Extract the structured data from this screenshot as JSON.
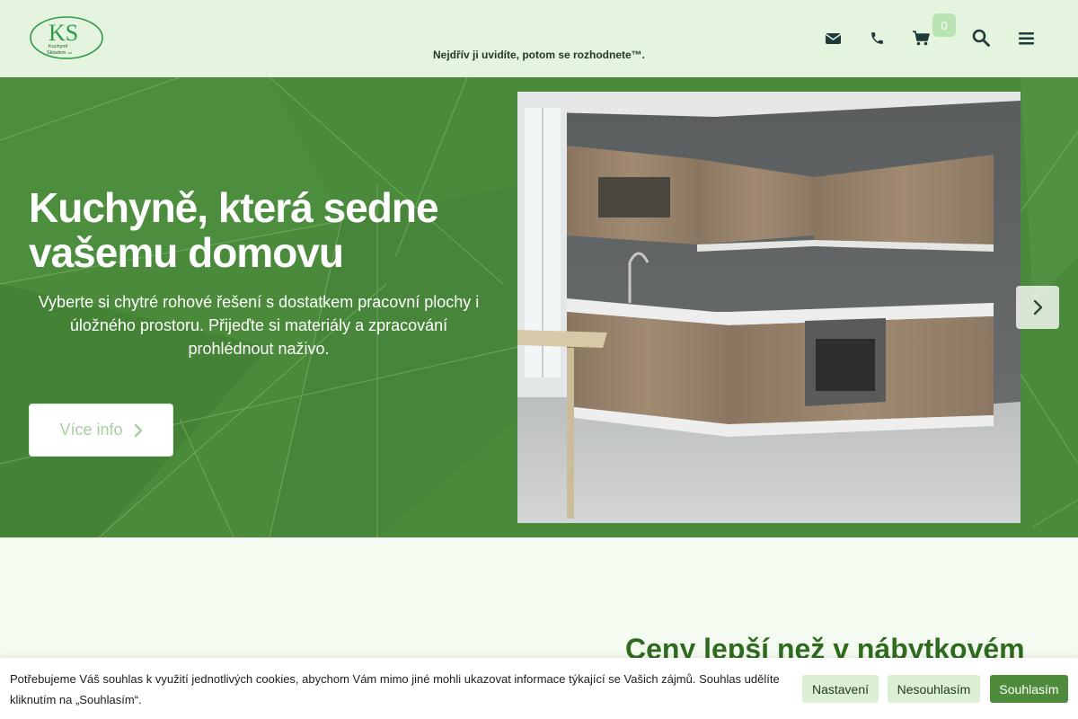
{
  "header": {
    "logo": {
      "letters": "KS",
      "line1": "Kuchyně",
      "line2": "Skladem",
      "suffix": ".cz"
    },
    "tagline": "Nejdřív ji uvidíte, potom se rozhodnete™.",
    "icons": [
      "envelope-icon",
      "phone-icon",
      "cart-icon",
      "search-icon",
      "menu-icon"
    ],
    "cart_count": "0"
  },
  "hero": {
    "title": "Kuchyně, která sedne vašemu domovu",
    "text": "Vyberte si chytré rohové řešení s dostatkem pracovní plochy i úložného prostoru. Přijeďte si materiály a zpracování prohlédnout naživo.",
    "button_label": "Více info"
  },
  "section": {
    "title": "Ceny lepší než v nábytkovém"
  },
  "cookie_bar": {
    "text": "Potřebujeme Váš souhlas k využití jednotlivých cookies, abychom Vám mimo jiné mohli ukazovat informace týkající se Vašich zájmů. Souhlas udělíte kliknutím na „Souhlasím“.",
    "settings_label": "Nastavení",
    "decline_label": "Nesouhlasím",
    "accept_label": "Souhlasím"
  },
  "colors": {
    "header_bg": "#e4f4df",
    "hero_green": "#4a8a3a",
    "accent_green": "#4e8c3c",
    "title_green": "#2f6b1f"
  }
}
